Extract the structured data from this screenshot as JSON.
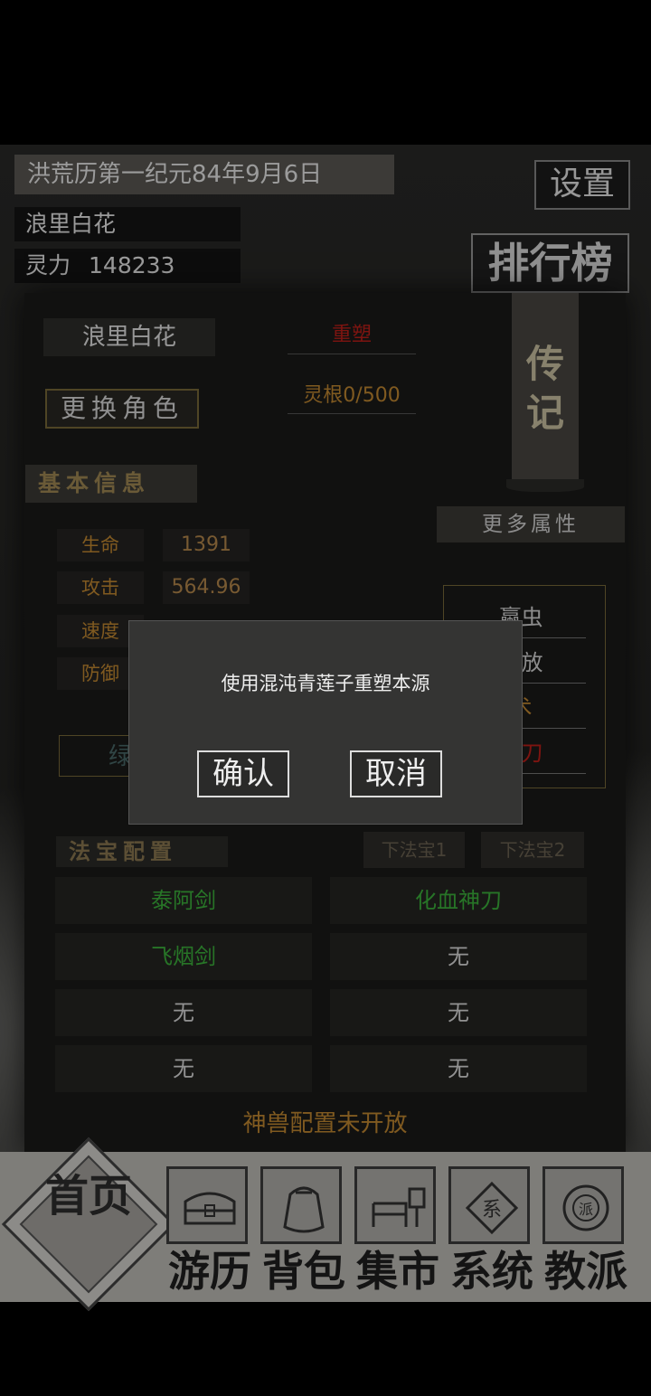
{
  "header": {
    "date": "洪荒历第一纪元84年9月6日",
    "name": "浪里白花",
    "lingli_label": "灵力",
    "lingli_value": "148233",
    "settings": "设置",
    "ranking": "排行榜"
  },
  "panel": {
    "char_name": "浪里白花",
    "change_role": "更换角色",
    "reshape": "重塑",
    "linggen": "灵根0/500",
    "biography": "传记",
    "basic_info": "基本信息",
    "more_attrs": "更多属性",
    "stats": [
      {
        "label": "生命",
        "value": "1391"
      },
      {
        "label": "攻击",
        "value": "564.96"
      },
      {
        "label": "速度",
        "value": ""
      },
      {
        "label": "防御",
        "value": ""
      }
    ],
    "attrs": [
      {
        "text": "蠃虫",
        "color": "#d8d8d8"
      },
      {
        "text": "开放",
        "color": "#d8d8d8"
      },
      {
        "text": "术",
        "color": "#c58a32"
      },
      {
        "text": "快刀",
        "color": "#c0201a"
      }
    ],
    "side_button": "绿",
    "fabao_title": "法宝配置",
    "fabao_tab1": "下法宝1",
    "fabao_tab2": "下法宝2",
    "fabao_slots": [
      {
        "text": "泰阿剑",
        "green": true
      },
      {
        "text": "化血神刀",
        "green": true
      },
      {
        "text": "飞烟剑",
        "green": true
      },
      {
        "text": "无",
        "green": false
      },
      {
        "text": "无",
        "green": false
      },
      {
        "text": "无",
        "green": false
      },
      {
        "text": "无",
        "green": false
      },
      {
        "text": "无",
        "green": false
      }
    ],
    "beast": "神兽配置未开放"
  },
  "dialog": {
    "message": "使用混沌青莲子重塑本源",
    "confirm": "确认",
    "cancel": "取消"
  },
  "nav": {
    "home": "首页",
    "items": [
      "游历",
      "背包",
      "集市",
      "系统",
      "教派"
    ],
    "icons": [
      "chest-icon",
      "bag-icon",
      "market-stall-icon",
      "system-seal-icon",
      "sect-icon"
    ]
  }
}
